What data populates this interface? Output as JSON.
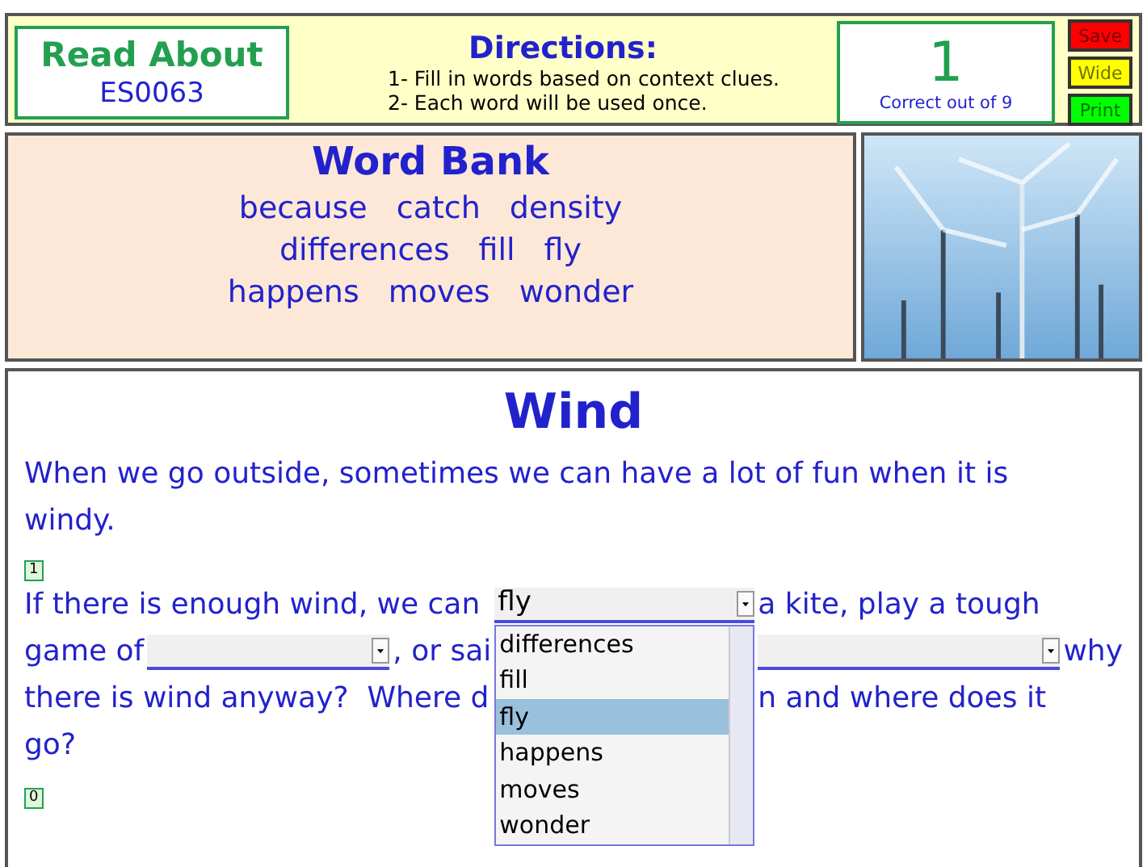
{
  "header": {
    "title": "Read About",
    "code": "ES0063",
    "directions_title": "Directions:",
    "directions": [
      "1- Fill in words based on context clues.",
      "2- Each word will be used once."
    ],
    "score": "1",
    "score_caption": "Correct out of 9",
    "buttons": [
      {
        "label": "Save",
        "color": "#ff0000"
      },
      {
        "label": "Wide",
        "color": "#ffff00"
      },
      {
        "label": "Print",
        "color": "#00ff00"
      }
    ]
  },
  "word_bank": {
    "title": "Word Bank",
    "rows": [
      [
        "because",
        "catch",
        "density"
      ],
      [
        "differences",
        "fill",
        "fly"
      ],
      [
        "happens",
        "moves",
        "wonder"
      ]
    ]
  },
  "story": {
    "title": "Wind",
    "intro": "When we go outside, sometimes we can have a lot of fun when it is windy.",
    "paragraphs": [
      {
        "number": "1",
        "lines": [
          {
            "left": [
              {
                "kind": "text",
                "text": "If there is enough wind, we can"
              }
            ],
            "middle": {
              "kind": "select",
              "value": "fly",
              "open": true
            },
            "right": [
              {
                "kind": "text",
                "text": "a kite, play a tough"
              }
            ]
          },
          {
            "left": [
              {
                "kind": "text",
                "text": "game of"
              },
              {
                "kind": "select"
              },
              {
                "kind": "text",
                "text": ", or sai"
              }
            ],
            "right": [
              {
                "kind": "select"
              },
              {
                "kind": "text",
                "text": "why"
              }
            ]
          },
          {
            "left": [
              {
                "kind": "text",
                "text": "there is wind anyway?  Where d"
              }
            ],
            "right": [
              {
                "kind": "text",
                "text": "n and where does it"
              }
            ]
          },
          {
            "left": [
              {
                "kind": "text",
                "text": "go?"
              }
            ]
          }
        ]
      },
      {
        "number": "0"
      }
    ]
  },
  "dropdown_list": {
    "items": [
      {
        "label": "differences",
        "selected": false
      },
      {
        "label": "fill",
        "selected": false
      },
      {
        "label": "fly",
        "selected": true
      },
      {
        "label": "happens",
        "selected": false
      },
      {
        "label": "moves",
        "selected": false
      },
      {
        "label": "wonder",
        "selected": false
      }
    ]
  }
}
